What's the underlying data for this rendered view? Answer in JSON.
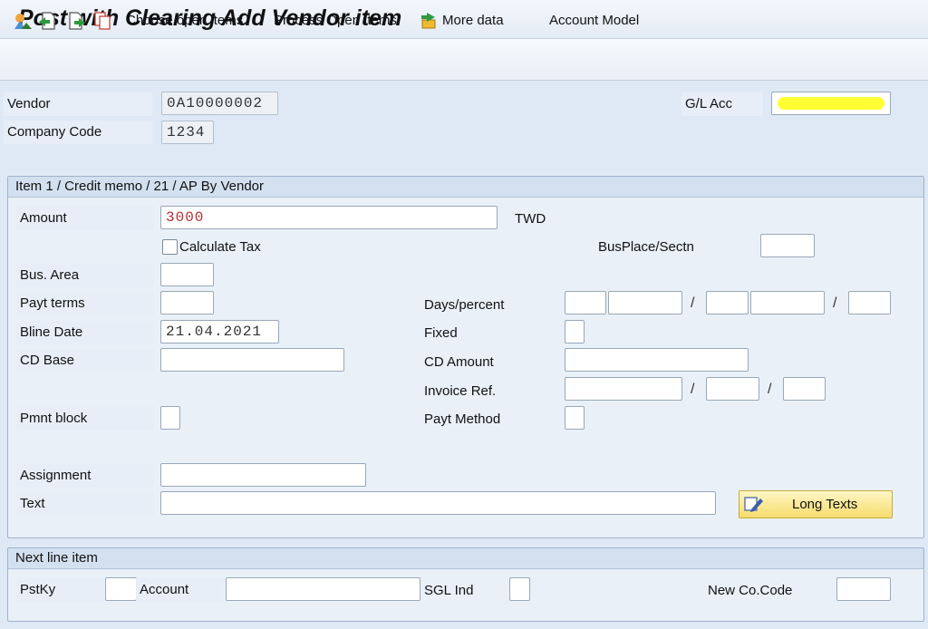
{
  "title": "Post with Clearing Add Vendor item",
  "toolbar": {
    "icons": [
      "overview-icon",
      "previous-icon",
      "next-icon",
      "copy-icon"
    ],
    "choose_open_items": "Choose open items",
    "process_open_items": "Process Open Items",
    "more_data": "More data",
    "account_model": "Account Model"
  },
  "header": {
    "vendor_label": "Vendor",
    "vendor_value": "0A10000002",
    "company_code_label": "Company Code",
    "company_code_value": "1234",
    "gl_acc_label": "G/L Acc",
    "gl_acc_value": ""
  },
  "item_panel": {
    "heading": "Item 1 / Credit memo / 21 / AP By Vendor",
    "amount_label": "Amount",
    "amount_value": "3000",
    "currency": "TWD",
    "calculate_tax_label": "Calculate Tax",
    "busplace_label": "BusPlace/Sectn",
    "bus_area_label": "Bus. Area",
    "payt_terms_label": "Payt terms",
    "days_percent_label": "Days/percent",
    "bline_date_label": "Bline Date",
    "bline_date_value": "21.04.2021",
    "fixed_label": "Fixed",
    "cd_base_label": "CD Base",
    "cd_amount_label": "CD Amount",
    "invoice_ref_label": "Invoice Ref.",
    "pmnt_block_label": "Pmnt block",
    "payt_method_label": "Payt Method",
    "assignment_label": "Assignment",
    "text_label": "Text",
    "long_texts_button": "Long Texts",
    "slash": "/"
  },
  "next_line": {
    "heading": "Next line item",
    "pstky_label": "PstKy",
    "account_label": "Account",
    "sgl_ind_label": "SGL Ind",
    "new_co_code_label": "New Co.Code"
  },
  "colors": {
    "amount_text": "#b03030",
    "highlight": "#ffff33"
  }
}
